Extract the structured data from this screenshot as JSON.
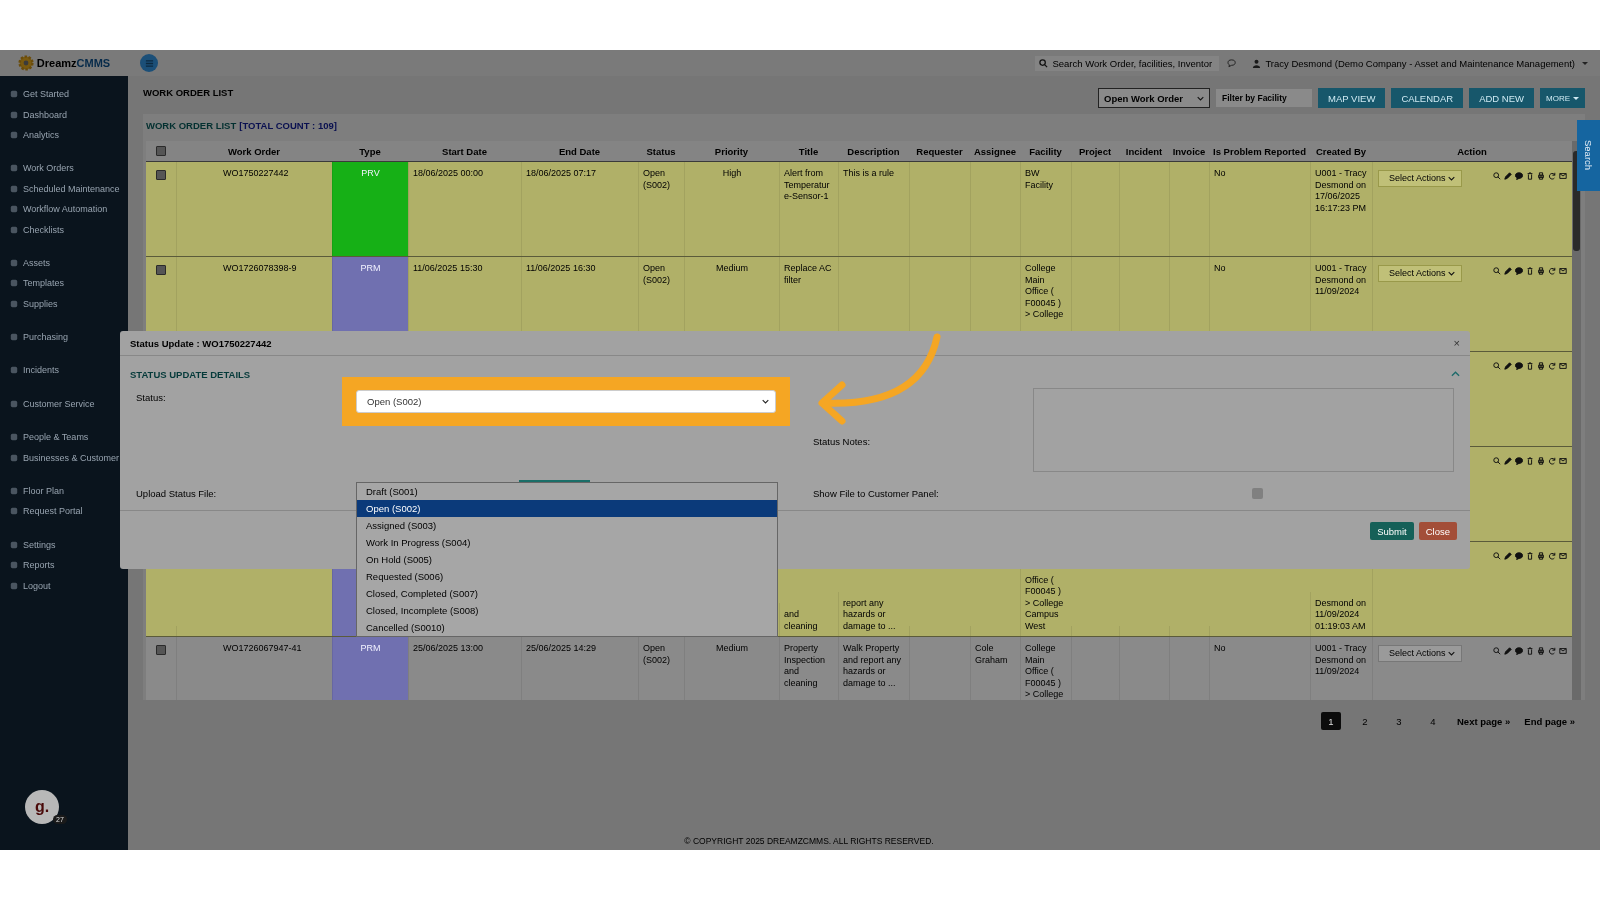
{
  "header": {
    "logo": {
      "part_1": "Dreamz",
      "part_2": "CMMS"
    },
    "search": {
      "placeholder": "Search Work Order, facilities, Inventor"
    },
    "user": "Tracy Desmond (Demo Company - Asset and Maintenance Management)"
  },
  "sidebar": {
    "groups": [
      {
        "items": [
          "Get Started",
          "Dashboard",
          "Analytics"
        ]
      },
      {
        "items": [
          "Work Orders",
          "Scheduled Maintenance",
          "Workflow Automation",
          "Checklists"
        ]
      },
      {
        "items": [
          "Assets",
          "Templates",
          "Supplies"
        ]
      },
      {
        "items": [
          "Purchasing"
        ]
      },
      {
        "items": [
          "Incidents"
        ]
      },
      {
        "items": [
          "Customer Service"
        ]
      },
      {
        "items": [
          "People & Teams",
          "Businesses & Customer"
        ]
      },
      {
        "items": [
          "Floor Plan",
          "Request Portal"
        ]
      },
      {
        "items": [
          "Settings",
          "Reports",
          "Logout"
        ]
      }
    ]
  },
  "page": {
    "title": "WORK ORDER LIST",
    "view_select": "Open Work Order",
    "filter": {
      "placeholder": "Filter by Facility"
    },
    "buttons": [
      "MAP VIEW",
      "CALENDAR",
      "ADD NEW"
    ],
    "more_button": "MORE"
  },
  "panel": {
    "title": "WORK ORDER LIST",
    "count": "[TOTAL COUNT : 109]"
  },
  "table": {
    "header_checkbox": {
      "checked": false
    },
    "columns": [
      "Work Order",
      "Type",
      "Start Date",
      "End Date",
      "Status",
      "Priority",
      "Title",
      "Description",
      "Requester",
      "Assignee",
      "Facility",
      "Project",
      "Incident",
      "Invoice",
      "Is Problem Reported",
      "Created By",
      "Action"
    ],
    "rows": [
      {
        "kind": "top",
        "highlighted": true,
        "checked": false,
        "work_order": "WO1750227442",
        "type": "PRV",
        "color": "#16b016",
        "start_date": "18/06/2025 00:00",
        "end_date": "18/06/2025 07:17",
        "status": "Open (S002)",
        "priority": "High",
        "title": "Alert from Temperature-Sensor-1",
        "description": "This is a rule",
        "facility": "BW Facility",
        "problem_reported": "No",
        "created_by": "U001 - Tracy Desmond on 17/06/2025 16:17:23 PM",
        "action": "Select Actions"
      },
      {
        "kind": "top",
        "highlighted": true,
        "checked": false,
        "work_order": "WO1726078398-9",
        "type": "PRM",
        "color": "#7070b0",
        "start_date": "11/06/2025 15:30",
        "end_date": "11/06/2025 16:30",
        "status": "Open (S002)",
        "priority": "Medium",
        "title": "Replace AC filter",
        "facility": "College Main Office ( F00045 ) > College",
        "problem_reported": "No",
        "created_by": "U001 - Tracy Desmond on 11/09/2024",
        "action": "Select Actions"
      },
      {
        "kind": "top",
        "highlighted": true
      },
      {
        "kind": "top",
        "highlighted": true
      },
      {
        "kind": "lower",
        "highlighted": true,
        "color": "#7070b0",
        "title": "and cleaning",
        "description": "report any hazards or damage to ...",
        "facility": "Office ( F00045 ) > College Campus West",
        "created_by": "Desmond on 11/09/2024 01:19:03 AM"
      },
      {
        "kind": "top",
        "highlighted": false,
        "checked": false,
        "work_order": "WO1726067947-41",
        "type": "PRM",
        "color": "#7070b0",
        "start_date": "25/06/2025 13:00",
        "end_date": "25/06/2025 14:29",
        "status": "Open (S002)",
        "priority": "Medium",
        "title": "Property Inspection and cleaning",
        "description": "Walk Property and report any hazards or damage to ...",
        "assignee": "Cole Graham",
        "facility": "College Main Office ( F00045 ) > College",
        "problem_reported": "No",
        "created_by": "U001 - Tracy Desmond on 11/09/2024",
        "action": "Select Actions"
      }
    ]
  },
  "pagination": [
    {
      "label": "1",
      "selected": true
    },
    {
      "label": "2",
      "selected": false
    },
    {
      "label": "3",
      "selected": false
    },
    {
      "label": "4",
      "selected": false
    }
  ],
  "pagination_links": [
    "Next page »",
    "End page »"
  ],
  "footer": "© COPYRIGHT 2025 DREAMZCMMS. ALL RIGHTS RESERVED.",
  "avatar": {
    "letter": "g.",
    "badge": "27"
  },
  "search_tab": "Search",
  "modal": {
    "title": "Status Update : WO1750227442",
    "close": "×",
    "section": "STATUS UPDATE DETAILS",
    "status_label": "Status:",
    "status_value": "Open (S002)",
    "notes_label": "Status Notes:",
    "upload_label": "Upload Status File:",
    "show_file_label": "Show File to Customer Panel:",
    "show_file_checked": false,
    "submit": "Submit",
    "cancel": "Close",
    "options": [
      {
        "label": "Draft (S001)",
        "selected": false
      },
      {
        "label": "Open (S002)",
        "selected": true
      },
      {
        "label": "Assigned (S003)",
        "selected": false
      },
      {
        "label": "Work In Progress (S004)",
        "selected": false
      },
      {
        "label": "On Hold (S005)",
        "selected": false
      },
      {
        "label": "Requested (S006)",
        "selected": false
      },
      {
        "label": "Closed, Completed (S007)",
        "selected": false
      },
      {
        "label": "Closed, Incomplete (S008)",
        "selected": false
      },
      {
        "label": "Cancelled (S0010)",
        "selected": false
      }
    ]
  }
}
